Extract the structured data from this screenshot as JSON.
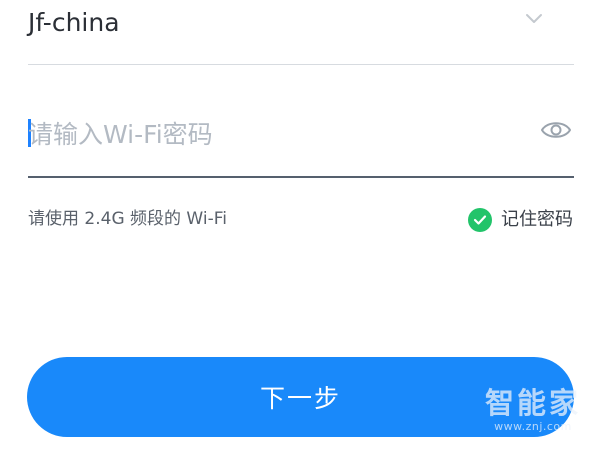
{
  "network": {
    "ssid": "Jf-china"
  },
  "password": {
    "placeholder": "请输入Wi-Fi密码",
    "value": ""
  },
  "hint": {
    "text": "请使用 2.4G 频段的 Wi-Fi"
  },
  "remember": {
    "label": "记住密码",
    "checked": true,
    "color": "#22c46a"
  },
  "next_button": {
    "label": "下一步",
    "color": "#1989fa"
  },
  "watermark": {
    "text": "智能家",
    "url": "www.znj.com"
  },
  "icons": {
    "dropdown": "chevron-down-icon",
    "visibility": "eye-icon",
    "check": "check-circle-icon"
  }
}
